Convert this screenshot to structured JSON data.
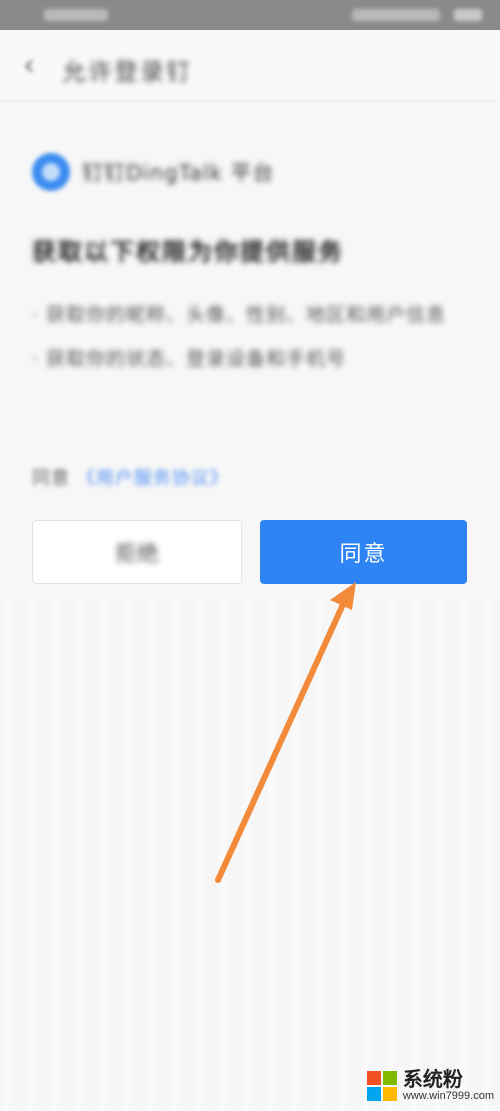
{
  "nav": {
    "back_icon": "chevron-left-icon",
    "title": "允许登录钉"
  },
  "app": {
    "logo_icon": "dingtalk-logo",
    "name": "钉钉DingTalk 平台"
  },
  "permissions": {
    "heading": "获取以下权限为你提供服务",
    "items": [
      "· 获取你的昵称、头像、性别、地区和用户信息",
      "· 获取你的状态、登录设备和手机号"
    ]
  },
  "agreement": {
    "prefix": "同意",
    "link": "《用户服务协议》"
  },
  "buttons": {
    "reject_label": "拒绝",
    "agree_label": "同意"
  },
  "colors": {
    "accent": "#2d84f2",
    "arrow": "#f28a3a"
  },
  "watermark": {
    "title": "系统粉",
    "url": "www.win7999.com"
  }
}
